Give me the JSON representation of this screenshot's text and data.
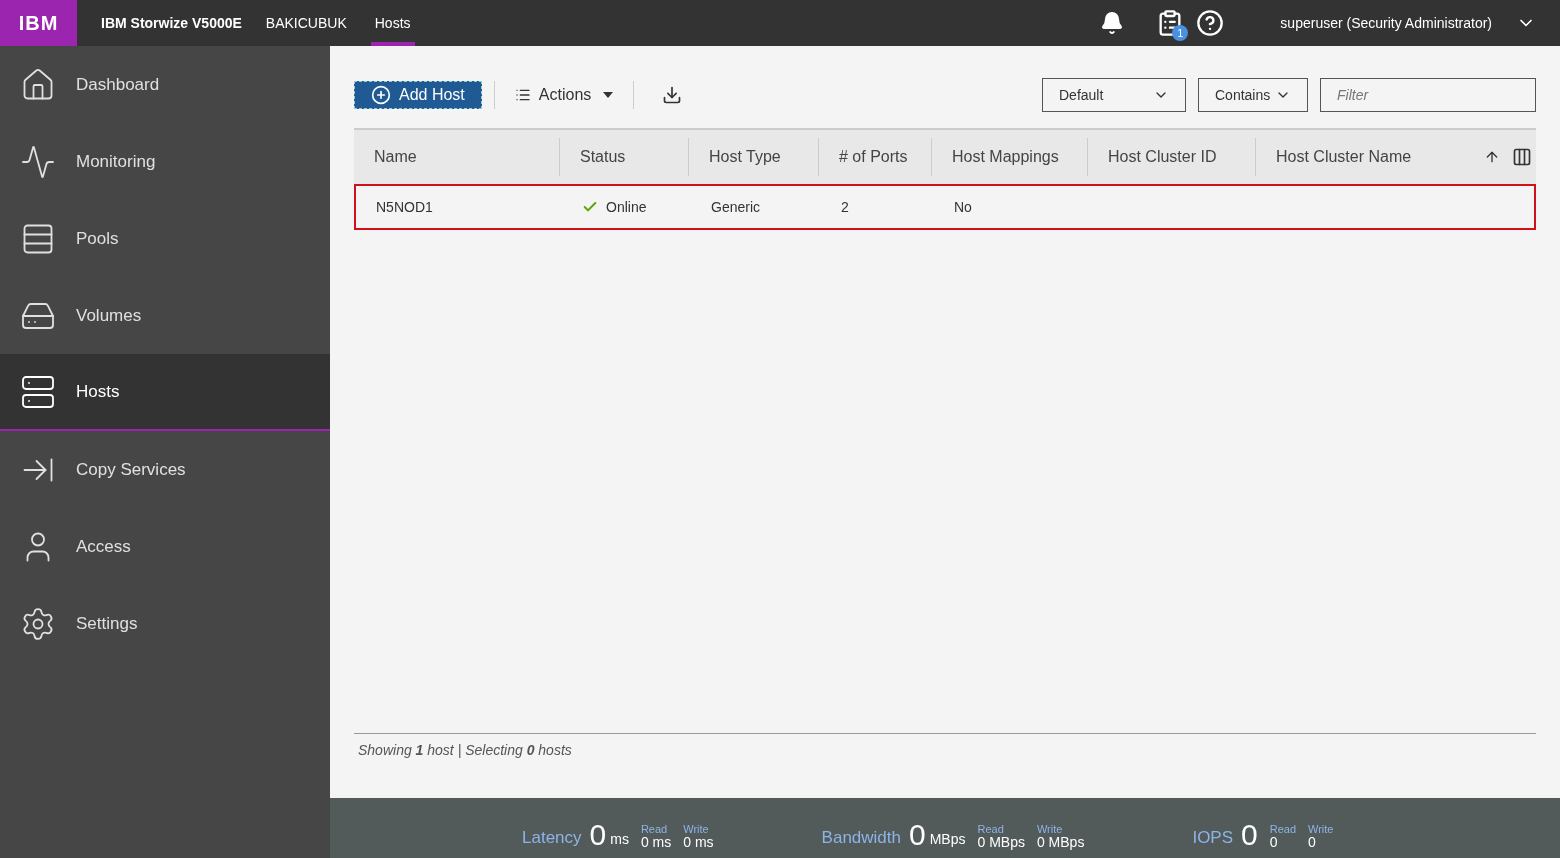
{
  "topbar": {
    "logo": "IBM",
    "product": "IBM Storwize V5000E",
    "system": "BAKICUBUK",
    "page": "Hosts",
    "tasks_badge": "1",
    "user": "superuser (Security Administrator)"
  },
  "sidebar": {
    "items": [
      {
        "label": "Dashboard",
        "kind": "dashboard",
        "selected": false
      },
      {
        "label": "Monitoring",
        "kind": "monitoring",
        "selected": false
      },
      {
        "label": "Pools",
        "kind": "pools",
        "selected": false
      },
      {
        "label": "Volumes",
        "kind": "volumes",
        "selected": false
      },
      {
        "label": "Hosts",
        "kind": "hosts",
        "selected": true
      },
      {
        "label": "Copy Services",
        "kind": "copy",
        "selected": false
      },
      {
        "label": "Access",
        "kind": "access",
        "selected": false
      },
      {
        "label": "Settings",
        "kind": "settings",
        "selected": false
      }
    ]
  },
  "toolbar": {
    "add_button": "Add Host",
    "actions": "Actions",
    "filter_column": "Default",
    "filter_mode": "Contains",
    "filter": {
      "placeholder": "Filter"
    }
  },
  "table": {
    "columns": [
      "Name",
      "Status",
      "Host Type",
      "# of Ports",
      "Host Mappings",
      "Host Cluster ID",
      "Host Cluster Name"
    ],
    "rows": [
      {
        "highlighted": true,
        "cells": [
          "N5NOD1",
          "Online",
          "Generic",
          "2",
          "No"
        ],
        "online": true
      }
    ]
  },
  "status_line": "Showing **1** host | Selecting **0** hosts",
  "metrics": [
    {
      "label": "Latency",
      "value": "0",
      "unit": "ms",
      "read_label": "Read",
      "read": "0 ms",
      "write_label": "Write",
      "write": "0 ms"
    },
    {
      "label": "Bandwidth",
      "value": "0",
      "unit": "MBps",
      "read_label": "Read",
      "read": "0 MBps",
      "write_label": "Write",
      "write": "0 MBps"
    },
    {
      "label": "IOPS",
      "value": "0",
      "read_label": "Read",
      "read": "0",
      "write_label": "Write",
      "write": "0"
    }
  ]
}
